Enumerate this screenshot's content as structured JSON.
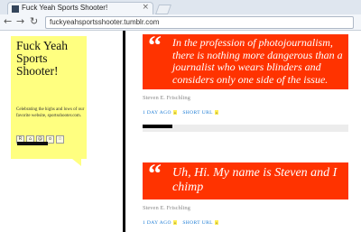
{
  "browser": {
    "tab_title": "Fuck Yeah Sports Shooter!",
    "tab_close": "×",
    "back": "←",
    "forward": "→",
    "reload": "↻",
    "url": "fuckyeahsportsshooter.tumblr.com"
  },
  "sidebar": {
    "title": "Fuck Yeah Sports Shooter!",
    "description": "Celebrating the highs and lows of our favorite website, sportsshooter.com.",
    "social_icons": [
      "rss-icon",
      "home-icon",
      "link-icon",
      "search-icon",
      "star-icon"
    ],
    "social_glyphs": [
      "R",
      "⌂",
      "@",
      "o",
      "☆"
    ]
  },
  "posts": [
    {
      "quote_mark": "“",
      "text": "In the profession of photojournalism, there is nothing more dangerous than a journalist who wears blinders and considers only one side of the issue.",
      "attribution": "Steven E. Frischling",
      "time": "1 DAY AGO",
      "short_url": "SHORT URL"
    },
    {
      "quote_mark": "“",
      "text": "Uh, Hi. My name is Steven and I chimp",
      "attribution": "Steven E. Frischling",
      "time": "1 DAY AGO",
      "short_url": "SHORT URL"
    }
  ],
  "colors": {
    "sidebar_bg": "#ffff80",
    "quote_bg": "#ff3300",
    "link": "#1a7ad4"
  }
}
